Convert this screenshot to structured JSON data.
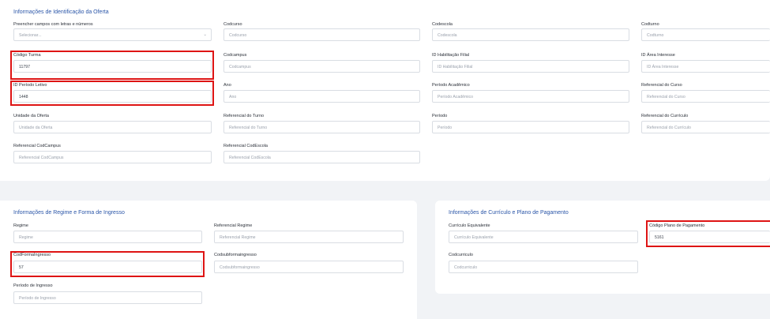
{
  "section1": {
    "title": "Informações de Identificação da Oferta",
    "fields": [
      {
        "label": "Preencher campos com letras e números",
        "value": "Selecionar...",
        "filled": false
      },
      {
        "label": "Codcurso",
        "value": "Codcurso",
        "filled": false
      },
      {
        "label": "Codescola",
        "value": "Codescola",
        "filled": false
      },
      {
        "label": "Codturno",
        "value": "Codturno",
        "filled": false
      },
      {
        "label": "Código Turma",
        "value": "11797",
        "filled": true
      },
      {
        "label": "Codcampus",
        "value": "Codcampus",
        "filled": false
      },
      {
        "label": "ID Habilitação Filial",
        "value": "ID Habilitação Filial",
        "filled": false
      },
      {
        "label": "ID Área Interesse",
        "value": "ID Área Interesse",
        "filled": false
      },
      {
        "label": "ID Período Letivo",
        "value": "1448",
        "filled": true
      },
      {
        "label": "Ano",
        "value": "Ano",
        "filled": false
      },
      {
        "label": "Período Acadêmico",
        "value": "Período Acadêmico",
        "filled": false
      },
      {
        "label": "Referencial do Curso",
        "value": "Referencial do Curso",
        "filled": false
      },
      {
        "label": "Unidade da Oferta",
        "value": "Unidade da Oferta",
        "filled": false
      },
      {
        "label": "Referencial do Turno",
        "value": "Referencial do Turno",
        "filled": false
      },
      {
        "label": "Período",
        "value": "Período",
        "filled": false
      },
      {
        "label": "Referencial do Currículo",
        "value": "Referencial do Currículo",
        "filled": false
      },
      {
        "label": "Referencial CodCampus",
        "value": "Referencial CodCampus",
        "filled": false
      },
      {
        "label": "Referencial CodEscola",
        "value": "Referencial CodEscola",
        "filled": false
      }
    ]
  },
  "section2": {
    "title": "Informações de Regime e Forma de Ingresso",
    "fields": [
      {
        "label": "Regime",
        "value": "Regime",
        "filled": false
      },
      {
        "label": "Referencial Regime",
        "value": "Referencial Regime",
        "filled": false
      },
      {
        "label": "CodFormaIngresso",
        "value": "57",
        "filled": true
      },
      {
        "label": "Codsubformaingresso",
        "value": "Codsubformaingresso",
        "filled": false
      },
      {
        "label": "Período de Ingresso",
        "value": "Período de Ingresso",
        "filled": false
      }
    ]
  },
  "section3": {
    "title": "Informações de Currículo e Plano de Pagamento",
    "fields": [
      {
        "label": "Currículo Equivalente",
        "value": "Currículo Equivalente",
        "filled": false
      },
      {
        "label": "Código Plano de Pagamento",
        "value": "5161",
        "filled": true
      },
      {
        "label": "Codcurriculo",
        "value": "Codcurriculo",
        "filled": false
      }
    ]
  },
  "colors": {
    "highlight": "#de1414",
    "title": "#2b56a8",
    "background": "#f1f3f6"
  }
}
